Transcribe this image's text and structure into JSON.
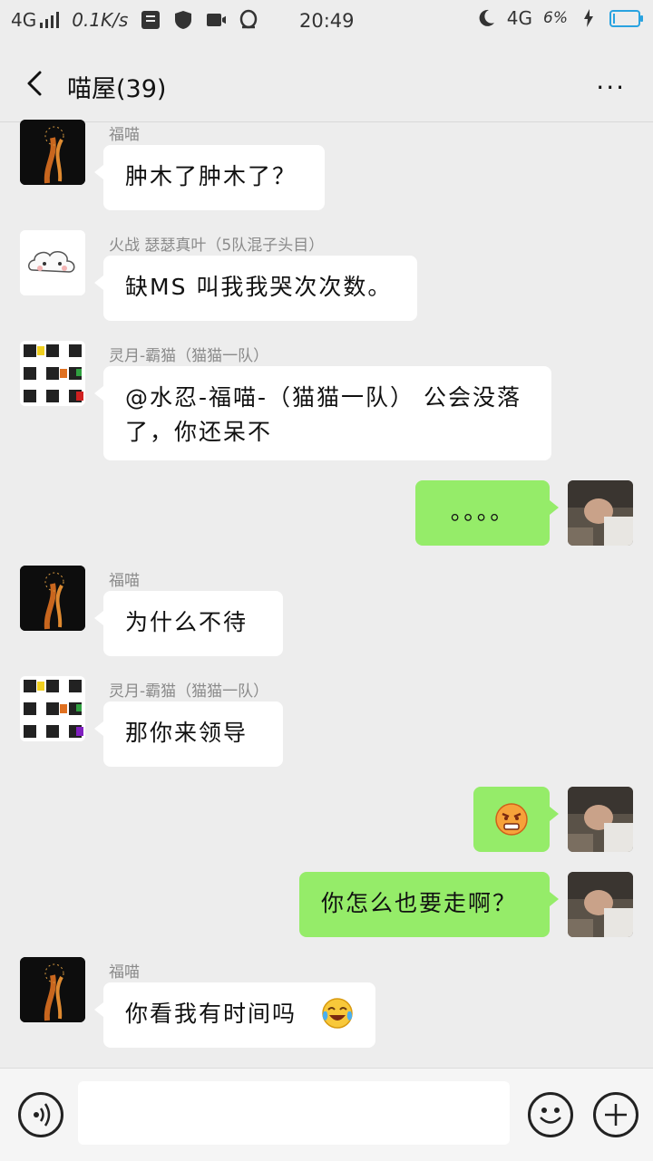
{
  "status": {
    "network_left": "4G",
    "speed": "0.1K/s",
    "time": "20:49",
    "network_right": "4G",
    "battery_text": "6%",
    "battery_percent": 6
  },
  "header": {
    "title": "喵屋(39)",
    "more": "···"
  },
  "messages": [
    {
      "side": "left",
      "sender": "福喵",
      "text": "肿木了肿木了？"
    },
    {
      "side": "left",
      "sender": "火战  瑟瑟真叶（5队混子头目）",
      "text": "缺MS 叫我我哭次次数。"
    },
    {
      "side": "left",
      "sender": "灵月-霸猫（猫猫一队）",
      "text": "@水忍-福喵-（猫猫一队） 公会没落了，你还呆不"
    },
    {
      "side": "right",
      "text": "。。。。"
    },
    {
      "side": "left",
      "sender": "福喵",
      "text": "为什么不待"
    },
    {
      "side": "left",
      "sender": "灵月-霸猫（猫猫一队）",
      "text": "那你来领导"
    },
    {
      "side": "right",
      "text": "",
      "emoji": "angry-face"
    },
    {
      "side": "right",
      "text": "你怎么也要走啊？"
    },
    {
      "side": "left",
      "sender": "福喵",
      "text": "你看我有时间吗",
      "emoji": "tears-of-joy"
    }
  ],
  "colors": {
    "background": "#ededed",
    "self_bubble": "#95ec69",
    "other_bubble": "#ffffff",
    "battery": "#29a3e0"
  }
}
